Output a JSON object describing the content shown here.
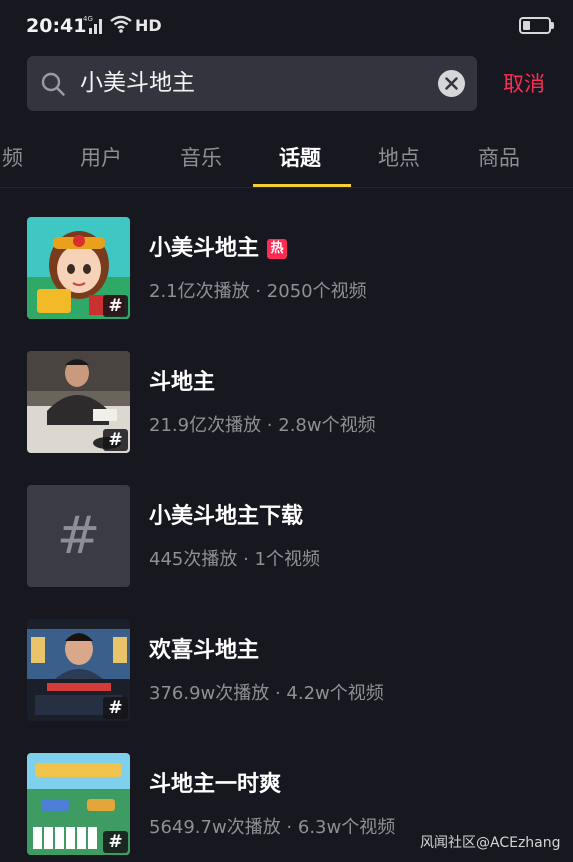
{
  "status_bar": {
    "time": "20:41",
    "network": "4G",
    "hd_label": "HD",
    "icons": [
      "signal-icon",
      "wifi-icon",
      "battery-icon"
    ]
  },
  "search": {
    "query": "小美斗地主",
    "cancel_label": "取消"
  },
  "tabs": [
    {
      "label": "频",
      "active": false
    },
    {
      "label": "用户",
      "active": false
    },
    {
      "label": "音乐",
      "active": false
    },
    {
      "label": "话题",
      "active": true
    },
    {
      "label": "地点",
      "active": false
    },
    {
      "label": "商品",
      "active": false
    }
  ],
  "topics": [
    {
      "title": "小美斗地主",
      "hot_badge": "热",
      "meta": "2.1亿次播放 · 2050个视频",
      "thumb_hash": "#"
    },
    {
      "title": "斗地主",
      "meta": "21.9亿次播放 · 2.8w个视频",
      "thumb_hash": "#"
    },
    {
      "title": "小美斗地主下载",
      "meta": "445次播放 · 1个视频",
      "thumb_hash": "#"
    },
    {
      "title": "欢喜斗地主",
      "meta": "376.9w次播放 · 4.2w个视频",
      "thumb_hash": "#"
    },
    {
      "title": "斗地主一时爽",
      "meta": "5649.7w次播放 · 6.3w个视频",
      "thumb_hash": "#"
    }
  ],
  "watermark": "风闻社区@ACEzhang",
  "colors": {
    "background": "#16171f",
    "accent_red": "#fe2c55",
    "tab_indicator": "#f5cf2d",
    "muted_text": "#8f9096"
  }
}
